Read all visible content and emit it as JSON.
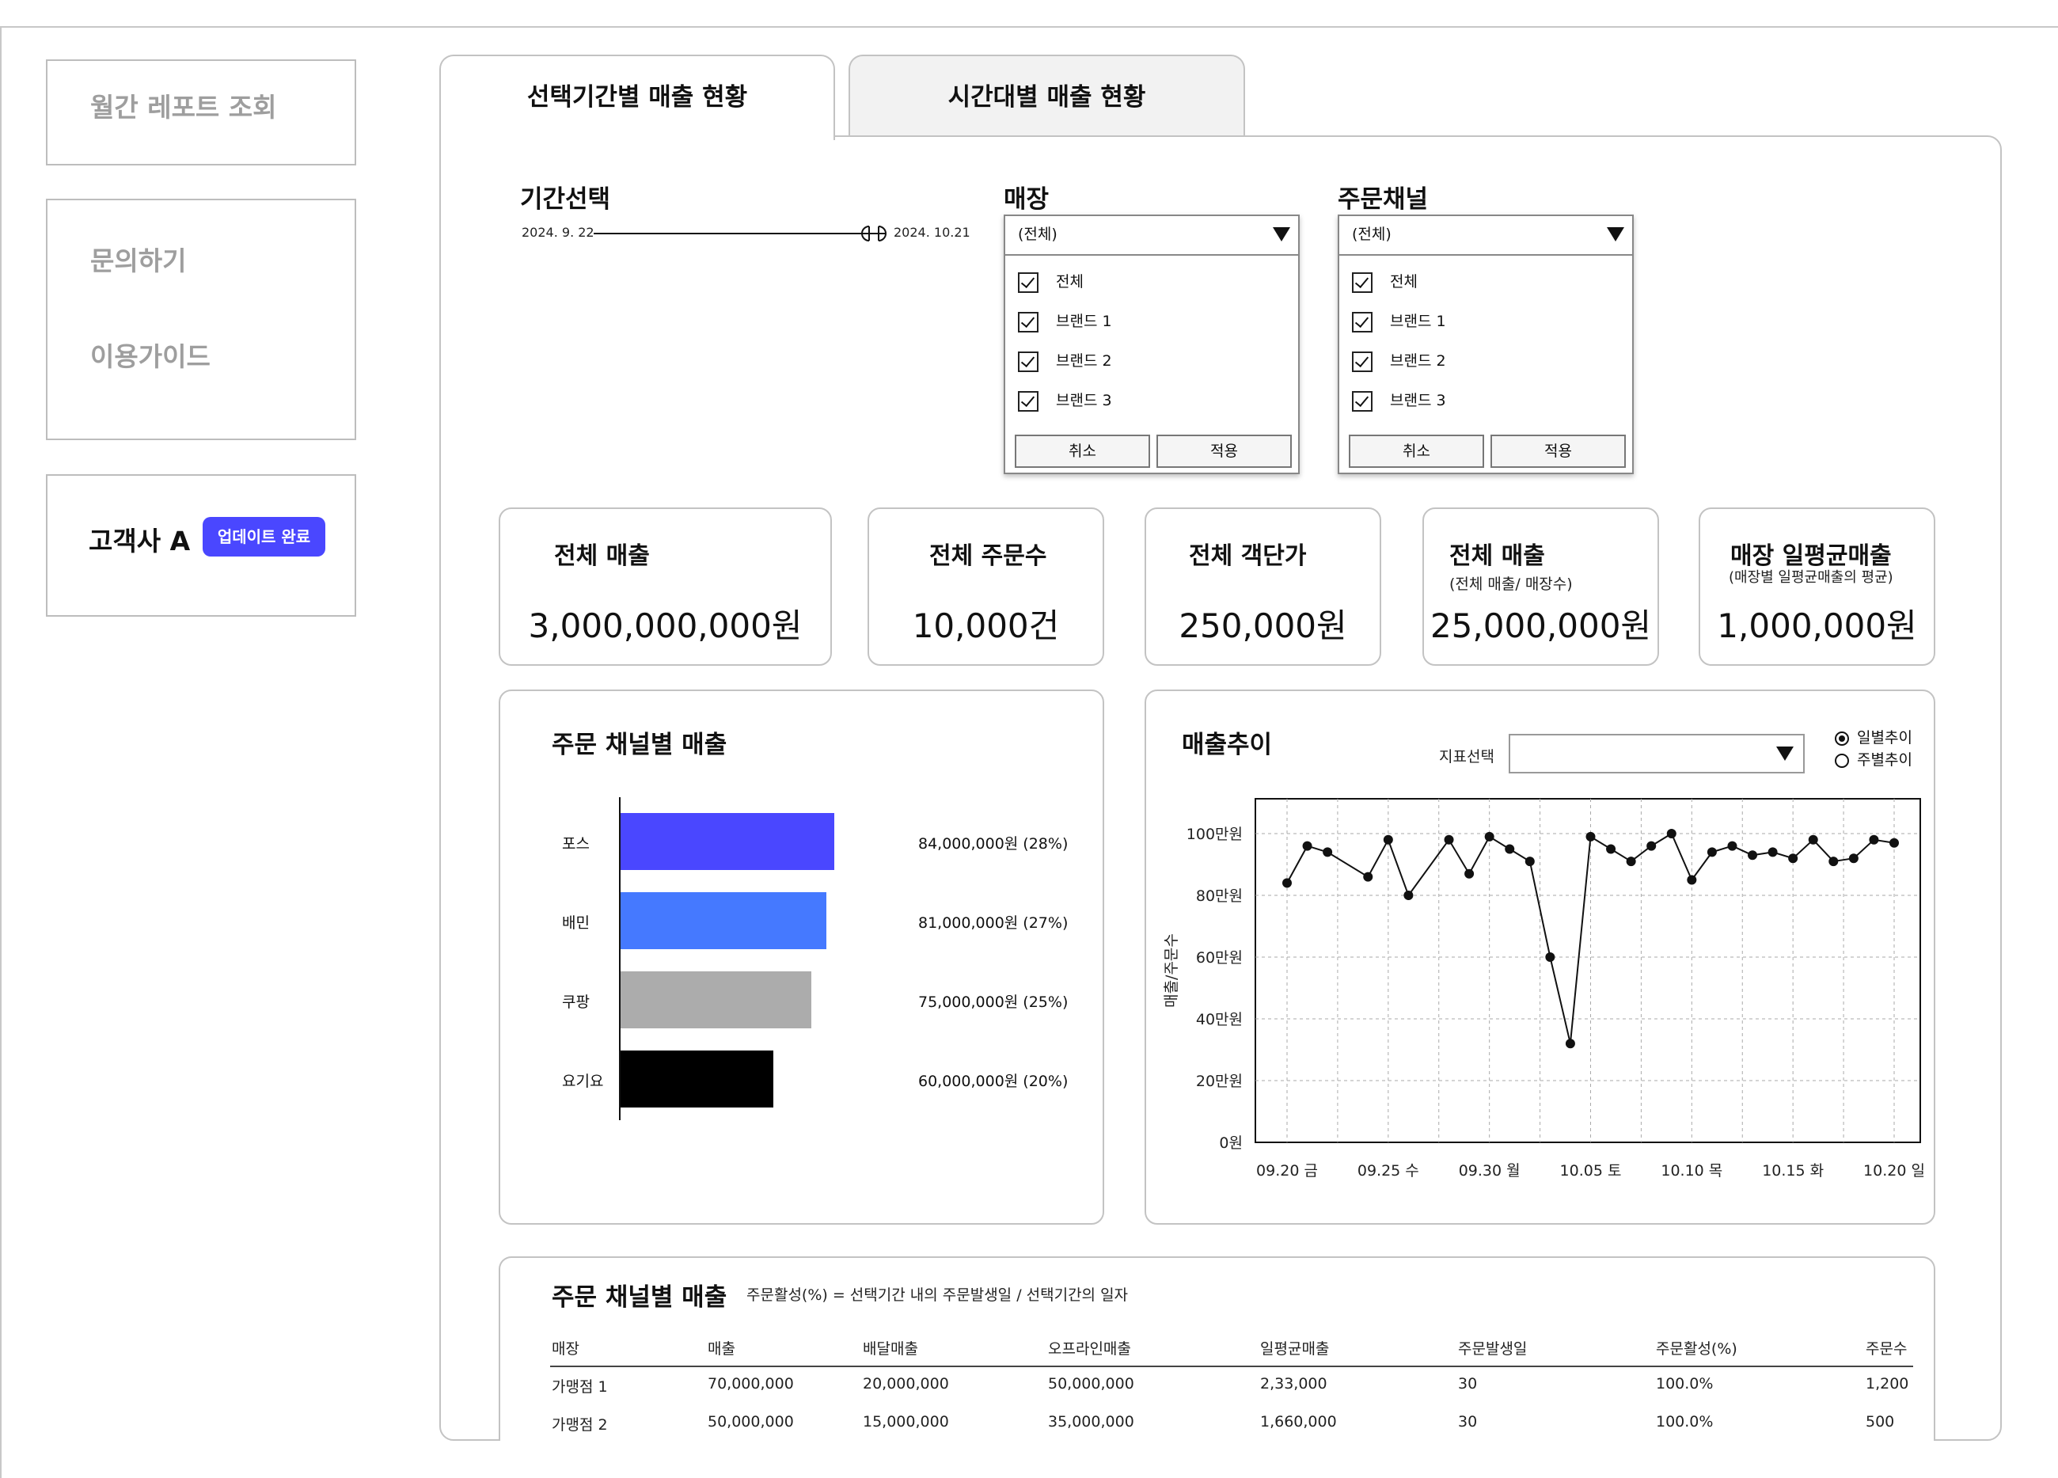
{
  "sidebar": {
    "monthly_report": "월간 레포트 조회",
    "inquiry": "문의하기",
    "guide": "이용가이드",
    "client_name": "고객사 A",
    "update_badge": "업데이트 완료"
  },
  "tabs": [
    {
      "label": "선택기간별 매출 현황",
      "active": true
    },
    {
      "label": "시간대별 매출 현황",
      "active": false
    }
  ],
  "period": {
    "label": "기간선택",
    "start": "2024. 9. 22",
    "end": "2024. 10.21"
  },
  "store_filter": {
    "label": "매장",
    "selected": "(전체)",
    "options": [
      "전체",
      "브랜드 1",
      "브랜드 2",
      "브랜드 3"
    ],
    "cancel": "취소",
    "apply": "적용"
  },
  "channel_filter": {
    "label": "주문채널",
    "selected": "(전체)",
    "options": [
      "전체",
      "브랜드 1",
      "브랜드 2",
      "브랜드 3"
    ],
    "cancel": "취소",
    "apply": "적용"
  },
  "kpis": [
    {
      "title": "전체 매출",
      "sub": "",
      "value": "3,000,000,000원"
    },
    {
      "title": "전체 주문수",
      "sub": "",
      "value": "10,000건"
    },
    {
      "title": "전체 객단가",
      "sub": "",
      "value": "250,000원"
    },
    {
      "title": "전체 매출",
      "sub": "(전체 매출/ 매장수)",
      "value": "25,000,000원"
    },
    {
      "title": "매장 일평균매출",
      "sub": "(매장별 일평균매출의 평균)",
      "value": "1,000,000원"
    }
  ],
  "channel_chart": {
    "title": "주문 채널별 매출",
    "colors": [
      "#4a47ff",
      "#4579ff",
      "#acacac",
      "#000000"
    ]
  },
  "trend": {
    "title": "매출추이",
    "metric_label": "지표선택",
    "metric_value": "",
    "radio_daily": "일별추이",
    "radio_weekly": "주별추이"
  },
  "table": {
    "title": "주문 채널별 매출",
    "note": "주문활성(%) = 선택기간 내의 주문발생일 / 선택기간의 일자",
    "headers": [
      "매장",
      "매출",
      "배달매출",
      "오프라인매출",
      "일평균매출",
      "주문발생일",
      "주문활성(%)",
      "주문수"
    ],
    "rows": [
      [
        "가맹점 1",
        "70,000,000",
        "20,000,000",
        "50,000,000",
        "2,33,000",
        "30",
        "100.0%",
        "1,200"
      ],
      [
        "가맹점 2",
        "50,000,000",
        "15,000,000",
        "35,000,000",
        "1,660,000",
        "30",
        "100.0%",
        "500"
      ]
    ]
  },
  "chart_data": [
    {
      "type": "bar",
      "orientation": "horizontal",
      "title": "주문 채널별 매출",
      "categories": [
        "포스",
        "배민",
        "쿠팡",
        "요기요"
      ],
      "values": [
        84000000,
        81000000,
        75000000,
        60000000
      ],
      "data_labels": [
        "84,000,000원 (28%)",
        "81,000,000원 (27%)",
        "75,000,000원 (25%)",
        "60,000,000원 (20%)"
      ]
    },
    {
      "type": "line",
      "title": "매출추이",
      "ylabel": "매출/주문수",
      "yticks": [
        "0원",
        "20만원",
        "40만원",
        "60만원",
        "80만원",
        "100만원"
      ],
      "ylim": [
        0,
        1000000
      ],
      "xticks": [
        "09.20 금",
        "09.25 수",
        "09.30 월",
        "10.05 토",
        "10.10 목",
        "10.15 화",
        "10.20 일"
      ],
      "x_start": "09.20",
      "x_end": "10.20",
      "grid": true,
      "x": [
        "09.20",
        "09.21",
        "09.22",
        "09.24",
        "09.25",
        "09.26",
        "09.28",
        "09.29",
        "09.30",
        "10.01",
        "10.02",
        "10.03",
        "10.04",
        "10.05",
        "10.06",
        "10.07",
        "10.08",
        "10.09",
        "10.10",
        "10.11",
        "10.12",
        "10.13",
        "10.14",
        "10.15",
        "10.16",
        "10.17",
        "10.18",
        "10.19",
        "10.20"
      ],
      "values": [
        840000,
        960000,
        940000,
        860000,
        980000,
        800000,
        980000,
        870000,
        990000,
        950000,
        910000,
        600000,
        320000,
        990000,
        950000,
        910000,
        960000,
        1000000,
        850000,
        940000,
        960000,
        930000,
        940000,
        920000,
        980000,
        910000,
        920000,
        980000,
        970000
      ]
    }
  ]
}
